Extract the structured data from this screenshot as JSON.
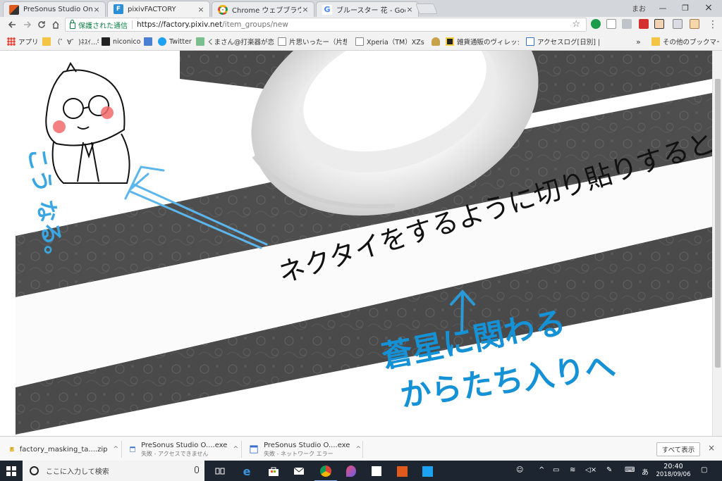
{
  "tabs": [
    {
      "title": "PreSonus Studio One | Pr",
      "icon": "presonus-icon",
      "color": "#e05a1e"
    },
    {
      "title": "pixivFACTORY",
      "icon": "pixiv-factory-icon",
      "color": "#2a8fd6"
    },
    {
      "title": "Chrome ウェブブラウザ",
      "icon": "chrome-icon",
      "color": "#4285f4"
    },
    {
      "title": "ブルースター 花 - Google 検",
      "icon": "google-icon",
      "color": "#4285f4"
    }
  ],
  "window": {
    "profile": "まお"
  },
  "address": {
    "secure_label": "保護された通信",
    "url_host": "https://factory.pixiv.net",
    "url_path": "/item_groups/new"
  },
  "bookmarks": [
    {
      "label": "アプリ",
      "icon": "apps-grid-icon"
    },
    {
      "label": "（゜∀゜)ﾈｽｲ...物",
      "icon": "folder-icon"
    },
    {
      "label": "niconico",
      "icon": "niconico-icon"
    },
    {
      "label": "",
      "icon": "bookmark-blue-icon"
    },
    {
      "label": "Twitter",
      "icon": "twitter-icon"
    },
    {
      "label": "くまさん@打楽器が恋し",
      "icon": "bookmark-picture-icon"
    },
    {
      "label": "片思いったー（片想い",
      "icon": "page-icon"
    },
    {
      "label": "Xperia（TM）XZs SC",
      "icon": "page-icon"
    },
    {
      "label": "",
      "icon": "crown-icon"
    },
    {
      "label": "雑貨通販のヴィレッジヴ",
      "icon": "village-icon"
    },
    {
      "label": "アクセスログ[日別] | JUI",
      "icon": "j-icon"
    }
  ],
  "bookmarks_more": "その他のブックマーク",
  "content": {
    "handwriting_main": "ネクタイをするように切り貼りすると",
    "handwriting_blue_1": "蒼星に関わる",
    "handwriting_blue_2": "からたち入りへ",
    "handwriting_side": "こう なる。"
  },
  "downloads": [
    {
      "name": "factory_masking_ta....zip",
      "status": "",
      "icon": "zip-icon"
    },
    {
      "name": "PreSonus Studio O....exe",
      "status": "失敗 - アクセスできません",
      "icon": "exe-icon"
    },
    {
      "name": "PreSonus Studio O....exe",
      "status": "失敗 - ネットワーク エラー",
      "icon": "exe-icon"
    }
  ],
  "downloads_show_all": "すべて表示",
  "taskbar": {
    "search_placeholder": "ここに入力して検索",
    "time": "20:40",
    "date": "2018/09/06",
    "ime": "あ"
  }
}
